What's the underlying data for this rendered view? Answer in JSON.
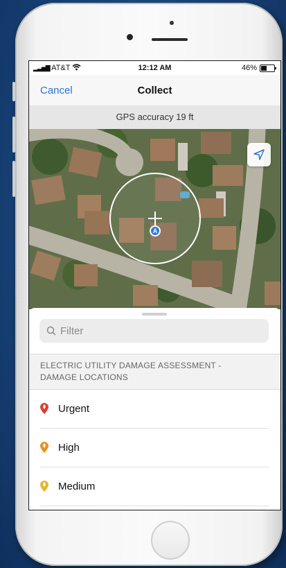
{
  "status_bar": {
    "carrier": "AT&T",
    "time": "12:12 AM",
    "battery": "46%",
    "battery_level": 0.46
  },
  "nav": {
    "cancel": "Cancel",
    "title": "Collect"
  },
  "gps": {
    "accuracy_text": "GPS accuracy 19 ft"
  },
  "map": {
    "marker_letter": "A",
    "icons": {
      "locate": "location-arrow-icon",
      "crosshair": "crosshair-icon"
    }
  },
  "sheet": {
    "filter_placeholder": "Filter",
    "section_header_line1": "ELECTRIC UTILITY DAMAGE ASSESSMENT -",
    "section_header_line2": "DAMAGE LOCATIONS",
    "items": [
      {
        "label": "Urgent",
        "color": "#d8422f"
      },
      {
        "label": "High",
        "color": "#e8921f"
      },
      {
        "label": "Medium",
        "color": "#e9b52a"
      }
    ]
  }
}
